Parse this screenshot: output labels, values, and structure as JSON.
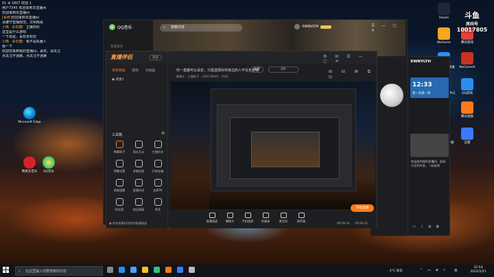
{
  "desktop": {
    "icons_left": [
      {
        "label": "Microsoft Edge"
      },
      {
        "label": "网易云音乐"
      },
      {
        "label": "QQ音乐"
      }
    ],
    "icons_right": [
      {
        "label": "Steam"
      },
      {
        "label": "WeGame"
      },
      {
        "label": "腾讯游戏"
      },
      {
        "label": "腾讯网络加速器"
      },
      {
        "label": "WeGameX"
      },
      {
        "label": "SUPER PEOPLE CBT"
      },
      {
        "label": "QQ游戏"
      },
      {
        "label": "GeForce"
      },
      {
        "label": "腾讯视频"
      },
      {
        "label": "WeGame外服"
      },
      {
        "label": "迅雷"
      }
    ],
    "watermark": {
      "line1": "斗鱼",
      "line2": "房间号",
      "line3": "10017805"
    }
  },
  "chat": {
    "lines": [
      {
        "name": "",
        "text": "01 ⊕ 1807   欢迎 1"
      },
      {
        "name": "",
        "text": "用户7345  欢迎来到本直播间"
      },
      {
        "name": "",
        "text": "欢迎来到本直播间"
      },
      {
        "name": "[系统]",
        "text": "欢迎来到本直播间"
      },
      {
        "name": "",
        "text": "请遵守直播规范，文明观看"
      },
      {
        "name": "小熊 · 彩虹糖：",
        "text": "主播你好"
      },
      {
        "name": "",
        "text": "这里是什么游戏"
      },
      {
        "name": "",
        "text": "一下再说，喜欢多玩玩"
      },
      {
        "name": "小熊 · 彩虹糖：",
        "text": "我不是机器人"
      },
      {
        "name": "",
        "text": "我一下"
      },
      {
        "name": "",
        "text": "欢迎您来到我的直播间，喜欢，请关注"
      },
      {
        "name": "",
        "text": "点关注不迷路，点关注不迷路"
      }
    ]
  },
  "qq_music": {
    "title": "QQ音乐",
    "search_placeholder": "搜索内容",
    "user": "XWNVLYH",
    "sidebar_item": "在线音乐"
  },
  "app": {
    "title": "直播伴侣",
    "badge": "测试",
    "tabs": [
      "场景管理",
      "游戏",
      "可视画"
    ],
    "scene": "场景1",
    "notice": "你一直都可以设定，只需选择好你身边的人不在身旁哦",
    "chip1": "新增",
    "chip2": "DIY",
    "source_label": "摄像头 · 主播助手",
    "live_id": "100178805",
    "viewers": "1562",
    "tools_title": "工具箱",
    "tools": [
      "弹幕助手",
      "观众互动",
      "主播任务",
      "弹幕设置",
      "录制回放",
      "礼物宝箱",
      "高能提醒",
      "直播间流",
      "连麦PK",
      "粉丝团",
      "商品橱窗",
      "更多"
    ],
    "toolbar": [
      "直播画面",
      "摄像头",
      "手机投屏",
      "多媒体",
      "麦克风",
      "扬声器"
    ],
    "live_button": "开始直播",
    "time1": "00:56:34",
    "time2": "00:56:22",
    "status_hint": "如何把素材添加到直播画面"
  },
  "stream_panel": {
    "name": "XWNYLYH",
    "clock": "12:33",
    "sub": "第一天第一场",
    "text": "欢迎来到我的直播间，很高兴见到大家，一起玩吧"
  },
  "taskbar": {
    "search_placeholder": "在这里输入你要搜索的内容",
    "weather": "-3°C 多云",
    "ime": "英",
    "time": "22:54",
    "date": "2022/1/21"
  },
  "colors": {
    "accent": "#ff7a1a",
    "app_bg": "#1e1f22",
    "taskbar": "#10141a"
  }
}
